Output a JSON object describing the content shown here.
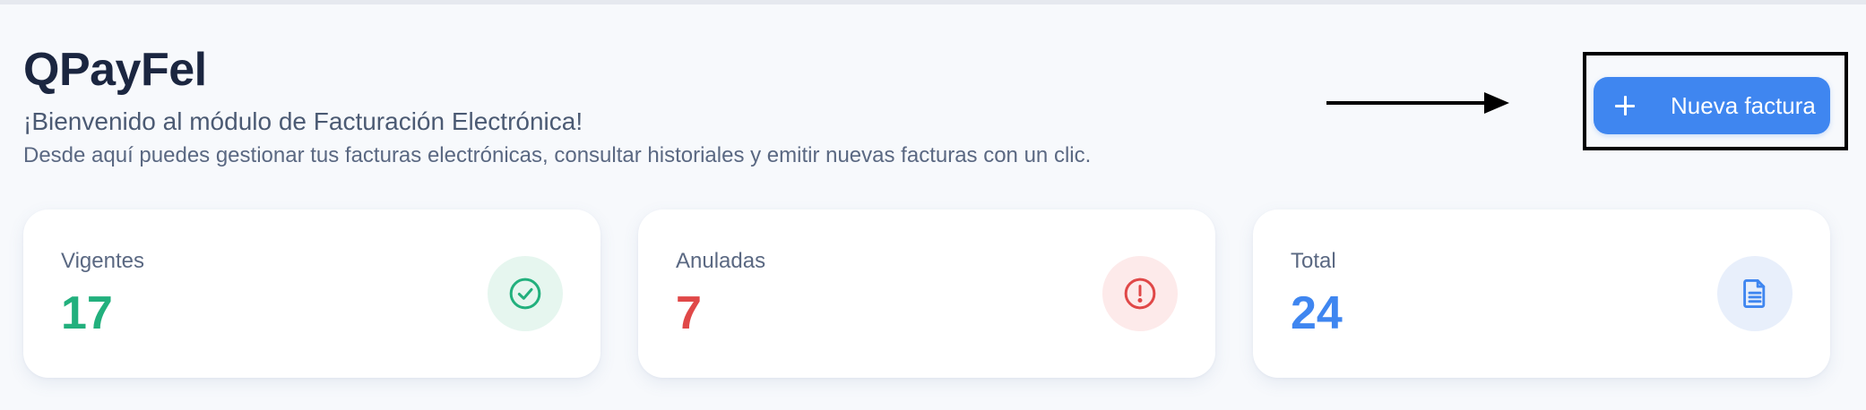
{
  "header": {
    "title": "QPayFel",
    "welcome": "¡Bienvenido al módulo de Facturación Electrónica!",
    "description": "Desde aquí puedes gestionar tus facturas electrónicas, consultar historiales y emitir nuevas facturas con un clic."
  },
  "actions": {
    "new_invoice_label": "Nueva factura",
    "new_invoice_icon": "plus-icon"
  },
  "stats": [
    {
      "label": "Vigentes",
      "value": "17",
      "color": "#22b07d",
      "icon": "check-circle-icon",
      "icon_bg": "#e6f6ef"
    },
    {
      "label": "Anuladas",
      "value": "7",
      "color": "#e04848",
      "icon": "alert-circle-icon",
      "icon_bg": "#fdeaea"
    },
    {
      "label": "Total",
      "value": "24",
      "color": "#3f86f0",
      "icon": "document-icon",
      "icon_bg": "#e8effb"
    }
  ],
  "accent": "#3f86f0"
}
